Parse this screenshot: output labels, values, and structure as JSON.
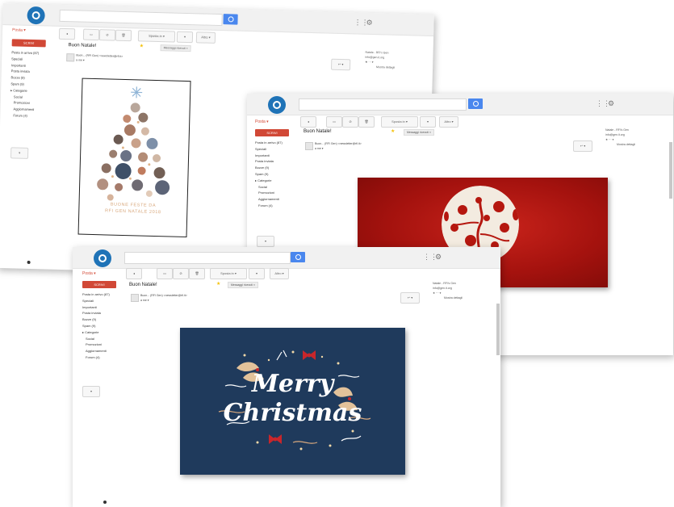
{
  "app": {
    "brand": "Posta ▾",
    "compose_label": "SCRIVI",
    "search_placeholder": "",
    "nav": [
      "Posta in arrivo (87)",
      "Speciali",
      "Importanti",
      "Posta inviata",
      "Bozze (9)",
      "Spam (9)",
      "▸ Categorie",
      "Social",
      "Promozioni",
      "Aggiornamenti",
      "Forum (4)"
    ],
    "toolbar": [
      "◂",
      "▭",
      "⊘",
      "🗑",
      "Sposta in ▾",
      "▾",
      "Altro ▾"
    ],
    "chat_label": "▾"
  },
  "message": {
    "subject": "Buon Natale!",
    "label": "Messaggi ricevuti ×",
    "sender": "Buon... (RFI Gen) <newsletter@rfi.it>",
    "to_line": "a me ▾",
    "right_panel": [
      "Natale - RFI's Gen",
      "info@gen.it.org",
      "★ ⋯  ▾",
      "Mostra dettagli"
    ]
  },
  "cards": {
    "white_caption_1": "BUONE FESTE DA",
    "white_caption_2": "RFI GEN NATALE 2018",
    "navy_line1": "Merry",
    "navy_line2": "Christmas"
  },
  "colors": {
    "accent_blue": "#4a87ee",
    "compose_red": "#d14836",
    "card_red": "#b5170f",
    "card_navy": "#1f3a5c",
    "gold": "#d9a97e"
  }
}
